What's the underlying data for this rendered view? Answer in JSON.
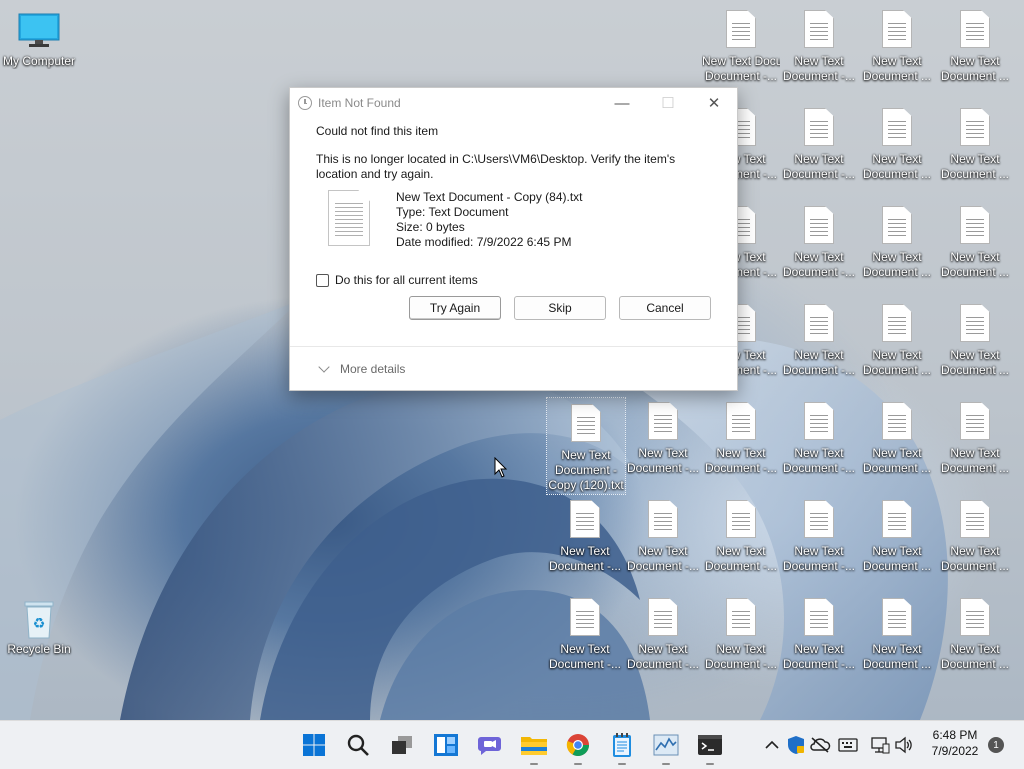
{
  "desktop": {
    "my_computer_label": "My Computer",
    "recycle_bin_label": "Recycle Bin",
    "file_label_short": "New Text Document -...",
    "file_label_trunc": "New Text Document ...",
    "selected_file_label": "New Text Document - Copy (120).txt"
  },
  "dialog": {
    "title": "Item Not Found",
    "heading": "Could not find this item",
    "message": "This is no longer located in C:\\Users\\VM6\\Desktop. Verify the item's location and try again.",
    "file_name": "New Text Document - Copy (84).txt",
    "file_type": "Type: Text Document",
    "file_size": "Size: 0 bytes",
    "file_date": "Date modified: 7/9/2022 6:45 PM",
    "checkbox_label": "Do this for all current items",
    "try_again_label": "Try Again",
    "skip_label": "Skip",
    "cancel_label": "Cancel",
    "more_details_label": "More details"
  },
  "taskbar": {
    "time": "6:48 PM",
    "date": "7/9/2022",
    "notification_count": "1",
    "icons": [
      "windows-start-icon",
      "search-icon",
      "task-view-icon",
      "widgets-icon",
      "chat-icon",
      "file-explorer-icon",
      "chrome-icon",
      "notepad-icon",
      "task-manager-icon",
      "terminal-icon"
    ]
  },
  "colors": {
    "accent": "#0067c0",
    "taskbar_bg": "#eef0f3",
    "dialog_bg": "#ffffff"
  }
}
